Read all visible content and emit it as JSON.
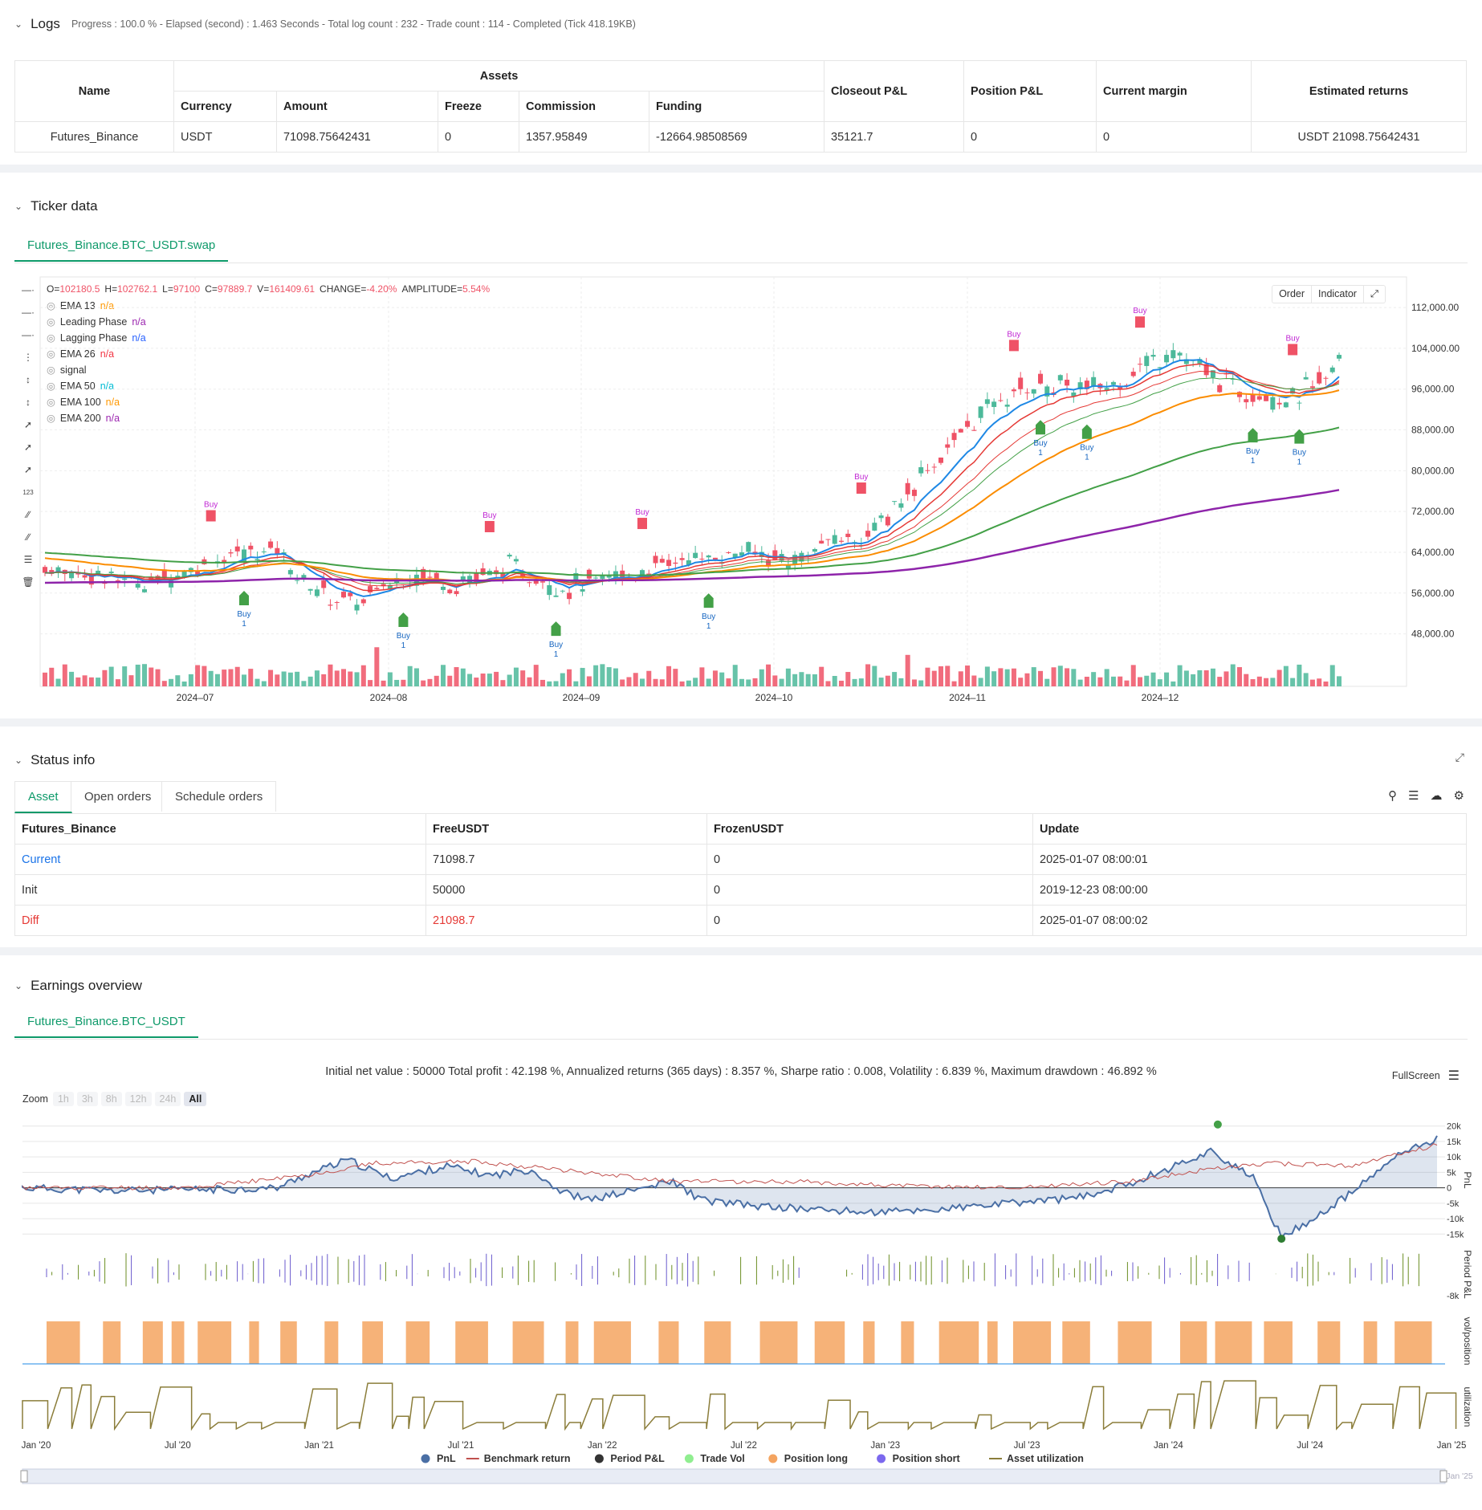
{
  "logs": {
    "title": "Logs",
    "summary": "Progress : 100.0 % - Elapsed (second) : 1.463  Seconds - Total log count : 232 - Trade count : 114 - Completed (Tick 418.19KB)",
    "table": {
      "h_name": "Name",
      "h_assets": "Assets",
      "h_currency": "Currency",
      "h_amount": "Amount",
      "h_freeze": "Freeze",
      "h_commission": "Commission",
      "h_funding": "Funding",
      "h_closeout": "Closeout P&L",
      "h_position": "Position P&L",
      "h_margin": "Current margin",
      "h_est": "Estimated returns",
      "row": {
        "name": "Futures_Binance",
        "currency": "USDT",
        "amount": "71098.75642431",
        "freeze": "0",
        "commission": "1357.95849",
        "funding": "-12664.98508569",
        "closeout": "35121.7",
        "position": "0",
        "margin": "0",
        "est": "USDT 21098.75642431"
      }
    }
  },
  "ticker": {
    "title": "Ticker data",
    "tab": "Futures_Binance.BTC_USDT.swap",
    "ohlc": {
      "o_lbl": "O=",
      "o": "102180.5",
      "h_lbl": "H=",
      "h": "102762.1",
      "l_lbl": "L=",
      "l": "97100",
      "c_lbl": "C=",
      "c": "97889.7",
      "v_lbl": "V=",
      "v": "161409.61",
      "chg_lbl": "CHANGE=",
      "chg": "-4.20%",
      "amp_lbl": "AMPLITUDE=",
      "amp": "5.54%"
    },
    "legend": [
      {
        "name": "EMA 13",
        "val": "n/a",
        "color": "#ff9800"
      },
      {
        "name": "Leading Phase",
        "val": "n/a",
        "color": "#9c27b0"
      },
      {
        "name": "Lagging Phase",
        "val": "n/a",
        "color": "#2962ff"
      },
      {
        "name": "EMA 26",
        "val": "n/a",
        "color": "#f23645"
      },
      {
        "name": "signal",
        "val": "",
        "color": "#333"
      },
      {
        "name": "EMA 50",
        "val": "n/a",
        "color": "#00bcd4"
      },
      {
        "name": "EMA 100",
        "val": "n/a",
        "color": "#ff9800"
      },
      {
        "name": "EMA 200",
        "val": "n/a",
        "color": "#9c27b0"
      }
    ],
    "btn_order": "Order",
    "btn_indicator": "Indicator",
    "y_ticks": [
      "112,000.00",
      "104,000.00",
      "96,000.00",
      "88,000.00",
      "80,000.00",
      "72,000.00",
      "64,000.00",
      "56,000.00",
      "48,000.00"
    ],
    "x_ticks": [
      "2024–07",
      "2024–08",
      "2024–09",
      "2024–10",
      "2024–11",
      "2024–12"
    ],
    "buy_label": "Buy",
    "one_label": "1",
    "colors": {
      "up": "#4cb99a",
      "down": "#ef5266",
      "ema_fast": "#1e88e5",
      "ema_red": "#e53935",
      "ema_orange": "#fb8c00",
      "ema_green": "#43a047",
      "ema_purple": "#8e24aa"
    }
  },
  "status": {
    "title": "Status info",
    "tabs": [
      "Asset",
      "Open orders",
      "Schedule orders"
    ],
    "headers": [
      "Futures_Binance",
      "FreeUSDT",
      "FrozenUSDT",
      "Update"
    ],
    "rows": [
      {
        "label": "Current",
        "free": "71098.7",
        "frozen": "0",
        "update": "2025-01-07 08:00:01",
        "color": "#1a73e8"
      },
      {
        "label": "Init",
        "free": "50000",
        "frozen": "0",
        "update": "2019-12-23 08:00:00",
        "color": "#333"
      },
      {
        "label": "Diff",
        "free": "21098.7",
        "frozen": "0",
        "update": "2025-01-07 08:00:02",
        "color": "#e53935"
      }
    ]
  },
  "earnings": {
    "title": "Earnings overview",
    "tab": "Futures_Binance.BTC_USDT",
    "summary": "Initial net value : 50000  Total profit : 42.198 %, Annualized returns (365 days) : 8.357 %, Sharpe ratio : 0.008, Volatility : 6.839 %, Maximum drawdown : 46.892 %",
    "fullscreen": "FullScreen",
    "zoom_label": "Zoom",
    "zoom_opts": [
      "1h",
      "3h",
      "8h",
      "12h",
      "24h",
      "All"
    ],
    "pnl_ticks": [
      "20k",
      "15k",
      "10k",
      "5k",
      "0",
      "-5k",
      "-10k",
      "-15k"
    ],
    "axis_titles": [
      "PnL",
      "Period P&L",
      "vol/position",
      "utilization"
    ],
    "period_tick": "-8k",
    "x_ticks": [
      "Jan '20",
      "Jul '20",
      "Jan '21",
      "Jul '21",
      "Jan '22",
      "Jul '22",
      "Jan '23",
      "Jul '23",
      "Jan '24",
      "Jul '24",
      "Jan '25"
    ],
    "legend": [
      {
        "name": "PnL",
        "color": "#4a6fa5"
      },
      {
        "name": "Benchmark return",
        "color": "#c0504d"
      },
      {
        "name": "Period P&L",
        "color": "#333"
      },
      {
        "name": "Trade Vol",
        "color": "#90ee90"
      },
      {
        "name": "Position long",
        "color": "#f4a460"
      },
      {
        "name": "Position short",
        "color": "#7b68ee"
      },
      {
        "name": "Asset utilization",
        "color": "#8b7d3a"
      }
    ]
  }
}
